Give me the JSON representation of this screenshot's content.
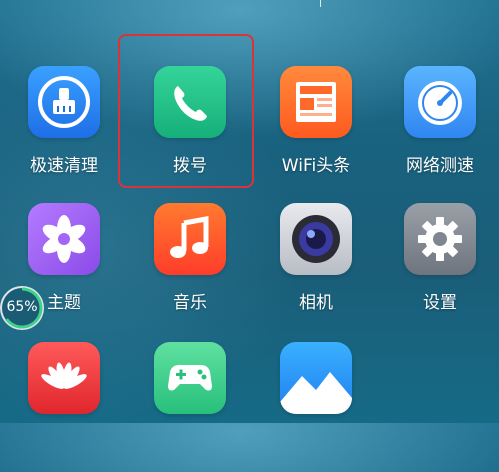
{
  "apps": [
    {
      "name": "极速清理",
      "icon": "broom-clean-icon"
    },
    {
      "name": "拨号",
      "icon": "phone-icon",
      "highlighted": true
    },
    {
      "name": "WiFi头条",
      "icon": "news-icon"
    },
    {
      "name": "网络测速",
      "icon": "speed-gauge-icon"
    },
    {
      "name": "主题",
      "icon": "pinwheel-icon"
    },
    {
      "name": "音乐",
      "icon": "music-note-icon"
    },
    {
      "name": "相机",
      "icon": "camera-lens-icon"
    },
    {
      "name": "设置",
      "icon": "gear-icon"
    },
    {
      "name": "",
      "icon": "huawei-logo-icon"
    },
    {
      "name": "",
      "icon": "game-controller-icon"
    },
    {
      "name": "",
      "icon": "gallery-icon"
    }
  ],
  "memory_badge": {
    "percent": "65%",
    "level": 0.65
  },
  "colors": {
    "highlight": "#d9343b"
  }
}
